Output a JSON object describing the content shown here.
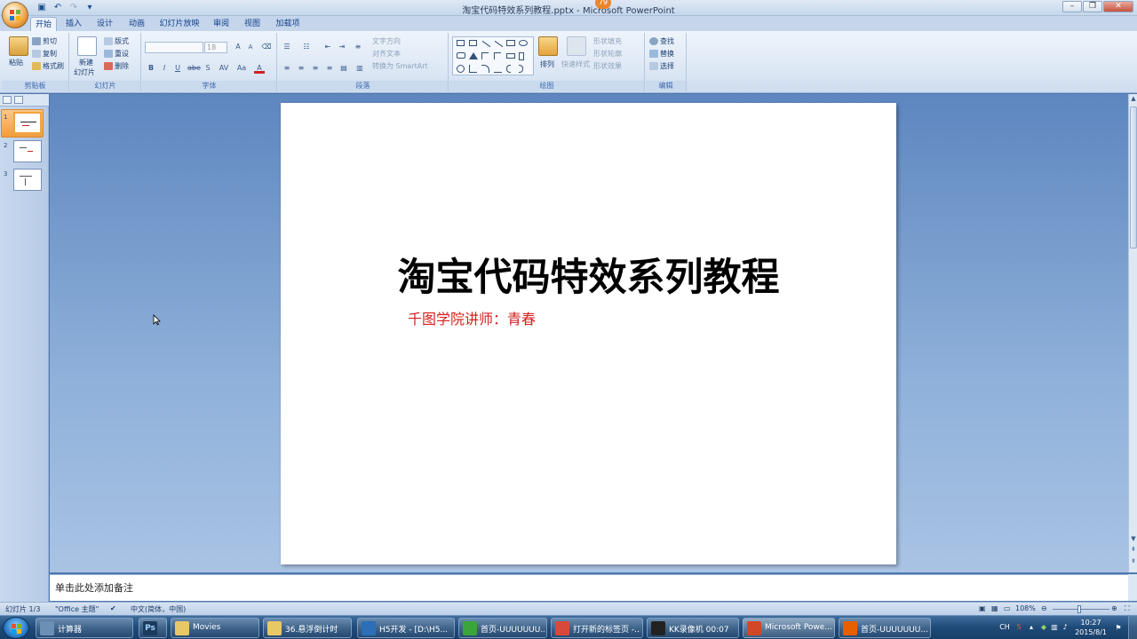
{
  "window": {
    "title": "淘宝代码特效系列教程.pptx - Microsoft PowerPoint",
    "badge": "79",
    "controls": [
      "–",
      "❐",
      "✕"
    ]
  },
  "tabs": [
    "开始",
    "插入",
    "设计",
    "动画",
    "幻灯片放映",
    "审阅",
    "视图",
    "加载项"
  ],
  "ribbon": {
    "clipboard": {
      "paste": "粘贴",
      "cut": "剪切",
      "copy": "复制",
      "format_painter": "格式刷",
      "label": "剪贴板"
    },
    "slides": {
      "new_slide_1": "新建",
      "new_slide_2": "幻灯片",
      "layout": "版式",
      "reset": "重设",
      "delete": "删除",
      "label": "幻灯片"
    },
    "font": {
      "size": "18",
      "label": "字体",
      "bold": "B",
      "italic": "I",
      "underline": "U",
      "strike": "abe",
      "shadow": "S",
      "spacing": "AV",
      "case": "Aa",
      "color": "A",
      "grow": "A",
      "shrink": "A"
    },
    "paragraph": {
      "text_direction": "文字方向",
      "align_text": "对齐文本",
      "smartart": "转换为 SmartArt",
      "label": "段落"
    },
    "drawing": {
      "arrange": "排列",
      "quick_styles": "快速样式",
      "shape_fill": "形状填充",
      "shape_outline": "形状轮廓",
      "shape_effects": "形状效果",
      "label": "绘图"
    },
    "editing": {
      "find": "查找",
      "replace": "替换",
      "select": "选择",
      "label": "编辑"
    }
  },
  "slides_pane": {
    "thumbnails": [
      {
        "number": "1",
        "selected": true
      },
      {
        "number": "2",
        "selected": false
      },
      {
        "number": "3",
        "selected": false
      }
    ]
  },
  "slide": {
    "title": "淘宝代码特效系列教程",
    "subtitle": "千图学院讲师：青春",
    "subtitle_color": "#d4201e"
  },
  "notes": {
    "placeholder": "单击此处添加备注"
  },
  "statusbar": {
    "slide_count": "幻灯片 1/3",
    "theme": "\"Office 主题\"",
    "language": "中文(简体，中国)",
    "zoom": "108%"
  },
  "taskbar": {
    "items": [
      {
        "label": "计算器",
        "icon": "calculator-icon",
        "color": "#6b8fb5"
      },
      {
        "label": "",
        "icon": "photoshop-icon",
        "color": "#1d3b5e"
      },
      {
        "label": "Movies",
        "icon": "folder-icon",
        "color": "#e8c766"
      },
      {
        "label": "36.悬浮倒计时",
        "icon": "folder-icon",
        "color": "#e8c766"
      },
      {
        "label": "H5开发 - [D:\\H5...",
        "icon": "webstorm-icon",
        "color": "#2a6fb8"
      },
      {
        "label": "首页-UUUUUUU...",
        "icon": "ie360-icon",
        "color": "#3aa53a"
      },
      {
        "label": "打开新的标签页 -...",
        "icon": "chrome-icon",
        "color": "#d9493a"
      },
      {
        "label": "KK录像机 00:07",
        "icon": "kk-recorder-icon",
        "color": "#222222"
      },
      {
        "label": "Microsoft Powe...",
        "icon": "powerpoint-icon",
        "color": "#d24726"
      },
      {
        "label": "首页-UUUUUUU...",
        "icon": "firefox-icon",
        "color": "#e66000"
      }
    ],
    "clock_time": "10:27",
    "clock_date": "2015/8/1",
    "tray_lang": "CH"
  }
}
